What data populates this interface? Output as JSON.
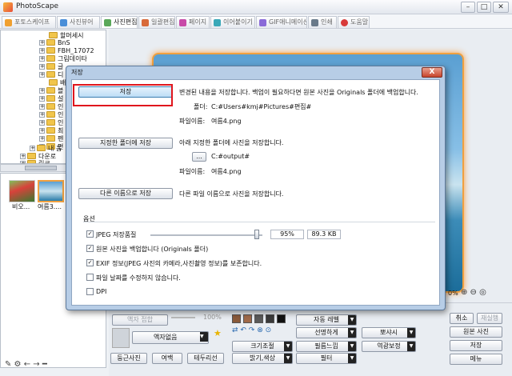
{
  "app": {
    "title": "PhotoScape"
  },
  "tabs": [
    {
      "label": "포토스케이프"
    },
    {
      "label": "사진뷰어"
    },
    {
      "label": "사진편집"
    },
    {
      "label": "일괄편집"
    },
    {
      "label": "페이지"
    },
    {
      "label": "이어붙이기"
    },
    {
      "label": "GIF애니메이션"
    },
    {
      "label": "인쇄"
    },
    {
      "label": "도움말"
    }
  ],
  "tree": [
    {
      "label": "할머세시"
    },
    {
      "label": "BnS"
    },
    {
      "label": "FBH_17072"
    },
    {
      "label": "그림데이타"
    },
    {
      "label": "글"
    },
    {
      "label": "디"
    },
    {
      "label": "배"
    },
    {
      "label": "블"
    },
    {
      "label": "설"
    },
    {
      "label": "인"
    },
    {
      "label": "인"
    },
    {
      "label": "인"
    },
    {
      "label": "최"
    },
    {
      "label": "펜"
    },
    {
      "label": "편"
    },
    {
      "label": "내 음"
    },
    {
      "label": "다운로"
    },
    {
      "label": "링크"
    }
  ],
  "thumbs": {
    "left_label": "비오...",
    "right_label": "여름3...."
  },
  "dialog": {
    "title": "저장",
    "close": "X",
    "save_button": "저장",
    "save_desc": "변경된 내용을 저장합니다. 백업이 필요하다면 원본 사진을 Originals 폴더에 백업합니다.",
    "folder_label": "폴더:",
    "folder_value": "C:#Users#kmj#Pictures#편집#",
    "filename_label": "파일이름:",
    "filename_value": "여름4.png",
    "save_to_folder_button": "지정한 폴더에 저장",
    "save_to_folder_desc": "아래 지정한 폴더에 사진을 저장합니다.",
    "browse_button": "...",
    "output_folder_value": "C:#output#",
    "filename_value_2": "여름4.png",
    "save_as_button": "다른 이름으로 저장",
    "save_as_desc": "다른 파일 이름으로 사진을 저장합니다.",
    "options_title": "옵션",
    "jpeg_quality_label": "JPEG 저장품질",
    "jpeg_quality_percent": "95%",
    "jpeg_size": "89.3 KB",
    "jpeg_quality_value": 0.95,
    "backup_label": "원본 사진을 백업합니다 (Originals 폴더)",
    "exif_label": "EXIF 정보(JPEG 사진의 카메라,사진촬영 정보)를 보존합니다.",
    "keep_date_label": "파일 날짜를 수정하지 않습니다.",
    "dpi_label": "DPI"
  },
  "editor": {
    "zoom_label": "0%",
    "frame_label": "액자 접합",
    "frame_value": "100%",
    "frame_name": "액자없음",
    "round_photo": "둥근사진",
    "margin": "여백",
    "border": "테두리선",
    "auto_level": "자동 레벨",
    "sharpen": "선명하게",
    "backlight": "역광보정",
    "filter_fx": "필름느낌",
    "resize": "크기조절",
    "brightness": "밝기,색상",
    "filter": "필터",
    "watermark": "뽀샤시",
    "cancel": "취소",
    "redo": "재실행",
    "original": "원본 사진",
    "save": "저장",
    "menu": "메뉴"
  },
  "colors": {
    "accent": "#e0161d",
    "dialog_frame": "#b7cde6",
    "save_button": "#bcdcf5"
  }
}
